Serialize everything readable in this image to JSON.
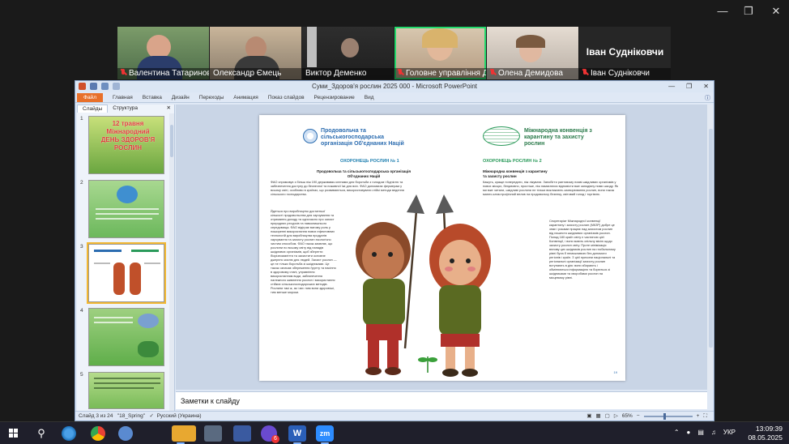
{
  "zoom": {
    "participants": [
      {
        "name": "Валентина Татаринова",
        "muted": true
      },
      {
        "name": "Олександр Ємець",
        "muted": false
      },
      {
        "name": "Виктор Деменко",
        "muted": false
      },
      {
        "name": "Головне управління  Де...",
        "muted": true,
        "active": true
      },
      {
        "name": "Олена Демидова",
        "muted": true
      },
      {
        "name": "Іван Судніковчи",
        "muted": true,
        "card": "Іван Судніковчи"
      }
    ]
  },
  "ppt": {
    "title": "Суми_Здоров'я рослин 2025 000  -  Microsoft PowerPoint",
    "file_tab": "Файл",
    "tabs": [
      "Главная",
      "Вставка",
      "Дизайн",
      "Переходы",
      "Анимация",
      "Показ слайдов",
      "Рецензирование",
      "Вид"
    ],
    "panel_tabs": [
      "Слайды",
      "Структура"
    ],
    "thumbs": [
      {
        "n": "1",
        "text": "12 травня Міжнародний ДЕНЬ ЗДОРОВ'Я РОСЛИН"
      },
      {
        "n": "2"
      },
      {
        "n": "3"
      },
      {
        "n": "4"
      },
      {
        "n": "5"
      }
    ],
    "notes_placeholder": "Заметки к слайду",
    "status": {
      "slide": "Слайд 3 из 24",
      "theme": "\"18_Spring\"",
      "lang": "Русский (Украина)",
      "zoom": "65%"
    }
  },
  "slide": {
    "fao_name": "Продовольча та сільськогосподарська організація Об'єднаних Націй",
    "ippc_name": "Міжнародна конвенція з карантину та захисту рослин",
    "left_head": "ОХОРОНЕЦЬ РОСЛИН № 1",
    "right_head": "ОХОРОНЕЦЬ РОСЛИН № 2",
    "left_sub": "Продовольча та сільськогосподарська організація Об'єднаних Націй",
    "right_sub": "Міжнародна конвенція з карантину та захисту рослин",
    "left_p1": "ФАО спрямовує з більш ніж 190 державами-членами для боротьби з голодом і бідністю та забезпечення доступу до безпечної та поживної їжі для всіх. ФАО допомагає фермерам у всьому світі, особливо в країнах, що розвиваються, використовувати стійкі методи ведення сільського господарства.",
    "left_p2": "Йдеться про виробництво достатньої кількості продовольства для харчування та отримання доходу та одночасно про захист природних ресурсів та навколишнього середовища. ФАО відіграє вагому роль у поширенні використання нових ефективних технологій для виробництва продуктів харчування та захисту рослин екологічно чистим способом. ФАО також заявляє, що рослини по всьому світу від нападів шкідливих організмів, щоб зберегти біорізноманіття та захистити основне джерело кисню для людей. Захист рослин — це не тільки боротьба зі шкідниками. Це також означає збереження ґрунту та насіння в здоровому стані, управління використанням води, забезпечення належного живлення рослин і використання стійких сільськогосподарських методів. Рослини такі ж, як і ми: ним вони здоровіші, тим менше мороки.",
    "right_p1": "Кажуть, краще попередити, ніж лікувати. Запобігти раптовому появі шкідливих організмів у нових місцях, безумовно, простіше, ніж намагатися відповісти вже заподіяну ними шкоду. Як ми вже читали, шкідливі рослини не тільки викликають захворювання рослин, вони також мають катастрофічний вплив на продовольчу безпеку, світовий голод і торгівлю.",
    "right_p2": "Секретаріат Міжнародної конвенції карантину і захисту рослин (МКЗР) добре це знає і роками працює над захистом рослин від нашестя шкідливих організмів рослин. Понад 180 країн світу є частиною цієї Конвенції, і вони мають спільну місію щодо захисту рослин світу. Проте мінімізація впливу цих шкідників рослин на глобальному рівні була б неможливою без допомоги регіонів і країн. З цієї причини національні та регіональні організації захисту рослин вступають в дію: вони збирають і обмінюються інформацією та борються зі шкідниками та хворобами рослин на місцевому рівні.",
    "page": "19"
  },
  "taskbar": {
    "lang": "УКР",
    "time": "13:09:39",
    "date": "08.05.2025",
    "badge": "6"
  }
}
